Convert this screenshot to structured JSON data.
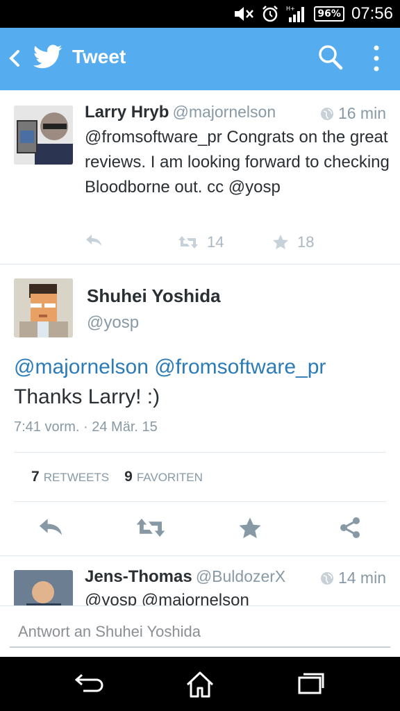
{
  "status_bar": {
    "battery": "96%",
    "time": "07:56",
    "network": "H+"
  },
  "app_bar": {
    "title": "Tweet"
  },
  "parent_tweet": {
    "name": "Larry Hryb",
    "handle": "@majornelson",
    "time": "16 min",
    "text": "@fromsoftware_pr Congrats on the great reviews. I am looking forward to checking Bloodborne out.   cc @yosp",
    "retweets": "14",
    "favorites": "18"
  },
  "main_tweet": {
    "name": "Shuhei Yoshida",
    "handle": "@yosp",
    "mention1": "@majornelson",
    "mention2": "@fromsoftware_pr",
    "text": "Thanks Larry! :)",
    "date": "7:41 vorm. · 24 Mär. 15",
    "retweets_count": "7",
    "retweets_label": "RETWEETS",
    "favorites_count": "9",
    "favorites_label": "FAVORITEN"
  },
  "reply_tweet": {
    "name": "Jens-Thomas",
    "handle": "@BuldozerX",
    "time": "14 min",
    "text": "@yosp @majornelson"
  },
  "composer": {
    "placeholder": "Antwort an Shuhei Yoshida"
  },
  "colors": {
    "accent": "#55acee",
    "link": "#2b7bb9",
    "muted": "#8899a6",
    "icon": "#aab8c2"
  }
}
